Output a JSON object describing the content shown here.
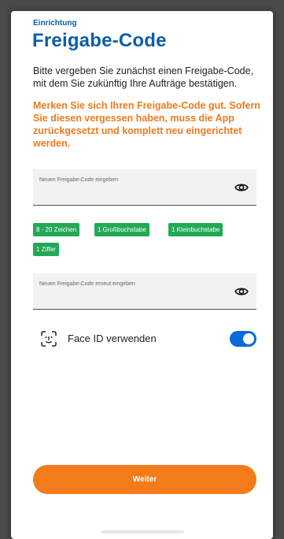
{
  "header": {
    "section_label": "Einrichtung",
    "title": "Freigabe-Code"
  },
  "intro_text": "Bitte vergeben Sie zunächst einen Freigabe-Code, mit dem Sie zukünftig Ihre Aufträge bestätigen.",
  "warning_text": "Merken Sie sich Ihren Freigabe-Code gut. Sofern Sie diesen vergessen haben, muss die App zurückgesetzt und komplett neu eingerichtet werden.",
  "fields": {
    "new_code": {
      "label": "Neuen Freigabe-Code eingeben",
      "value": ""
    },
    "repeat_code": {
      "label": "Neuen Freigabe-Code erneut eingeben",
      "value": ""
    }
  },
  "requirements": [
    "8 - 20 Zeichen",
    "1 Großbuchstabe",
    "1 Kleinbuchstabe",
    "1 Ziffer"
  ],
  "faceid": {
    "label": "Face ID verwenden",
    "enabled": true
  },
  "primary_button": "Weiter",
  "colors": {
    "brand_blue": "#0a5ea8",
    "warning_orange": "#f07a1f",
    "chip_green": "#22a856",
    "toggle_blue": "#0a6ad9",
    "button_orange": "#f47b1a"
  },
  "icons": {
    "password_visibility": "eye-icon",
    "faceid": "face-id-icon"
  }
}
